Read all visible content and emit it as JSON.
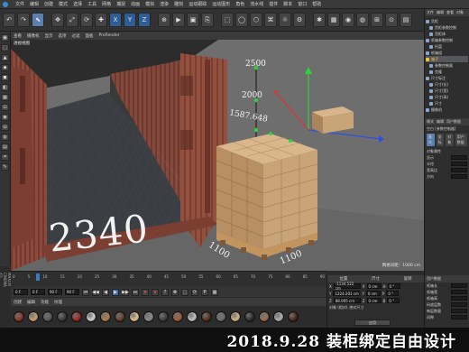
{
  "menubar": {
    "items": [
      "文件",
      "编辑",
      "创建",
      "模式",
      "选择",
      "工具",
      "网格",
      "捕捉",
      "动画",
      "模拟",
      "渲染",
      "雕刻",
      "运动跟踪",
      "运动图形",
      "角色",
      "流水线",
      "插件",
      "脚本",
      "窗口",
      "帮助"
    ]
  },
  "toolbar": {
    "buttons": [
      "↶",
      "↷",
      "⬉",
      "✥",
      "⤢",
      "⟳",
      "✚",
      "X",
      "Y",
      "Z",
      "⊕",
      "▶",
      "▣",
      "⎘",
      "⬚",
      "◯",
      "⬡",
      "⌘",
      "☼",
      "⚙",
      "✱",
      "▦",
      "◉",
      "◍",
      "⊞",
      "⊙",
      "▤"
    ]
  },
  "left_tools": {
    "buttons": [
      "▣",
      "⬚",
      "▲",
      "◆",
      "◼",
      "◧",
      "▦",
      "⊡",
      "◉",
      "⊟",
      "◍",
      "▤",
      "⌗",
      "✎"
    ],
    "vertical_label": "MAXON CINEMA 4D"
  },
  "viewport": {
    "menu": [
      "查看",
      "摄像机",
      "显示",
      "选项",
      "过滤",
      "面板",
      "ProRender"
    ],
    "title": "透视视图",
    "grid_readout": "网格间距：1000 cm",
    "dimensions": {
      "d2500": "2500",
      "d2000": "2000",
      "d1587": "1587.648",
      "d2340": "2340",
      "d1100a": "1100",
      "d1100b": "1100"
    }
  },
  "object_manager": {
    "tabs": [
      "文件",
      "编辑",
      "查看",
      "对象"
    ],
    "items": [
      {
        "label": "货柜",
        "indent": 0,
        "highlight": false
      },
      {
        "label": "货柜参数控制",
        "indent": 1,
        "highlight": false
      },
      {
        "label": "货柜体",
        "indent": 1,
        "highlight": false
      },
      {
        "label": "纸箱参数控制",
        "indent": 0,
        "highlight": false
      },
      {
        "label": "托盘",
        "indent": 1,
        "highlight": false
      },
      {
        "label": "纸箱组",
        "indent": 0,
        "highlight": false
      },
      {
        "label": "箱子",
        "indent": 0,
        "highlight": true
      },
      {
        "label": "参数控制器",
        "indent": 1,
        "highlight": false
      },
      {
        "label": "克隆",
        "indent": 1,
        "highlight": false
      },
      {
        "label": "尺寸标注",
        "indent": 0,
        "highlight": false
      },
      {
        "label": "尺寸(长)",
        "indent": 1,
        "highlight": false
      },
      {
        "label": "尺寸(宽)",
        "indent": 1,
        "highlight": false
      },
      {
        "label": "尺寸(高)",
        "indent": 1,
        "highlight": false
      },
      {
        "label": "尺寸",
        "indent": 1,
        "highlight": false
      },
      {
        "label": "摄像机",
        "indent": 0,
        "highlight": false
      }
    ]
  },
  "attributes": {
    "tabs": [
      "模式",
      "编辑",
      "用户数据"
    ],
    "object_label": "空白 [参数控制器]",
    "sub_tabs": [
      "基本",
      "坐标",
      "对象",
      "用户数据"
    ],
    "section": "对象属性",
    "rows": [
      "显示",
      "半径",
      "宽高比",
      "方向"
    ],
    "user_data_title": "用户数据",
    "user_rows": [
      "纸箱长",
      "纸箱宽",
      "纸箱高",
      "码放层数",
      "每层数量",
      "间隙",
      "托盘尺寸",
      "托盘高",
      "偏移",
      "纸箱重"
    ]
  },
  "timeline": {
    "ticks": [
      "0",
      "5",
      "10",
      "15",
      "20",
      "25",
      "30",
      "35",
      "40",
      "45",
      "50",
      "55",
      "60",
      "65",
      "70",
      "75",
      "80",
      "85",
      "90"
    ],
    "current_frame": "0 F",
    "start_field": "0 F",
    "end_field": "90 F",
    "end_field2": "90 F",
    "buttons": [
      "⏮",
      "◀◀",
      "◀",
      "▶",
      "▶▶",
      "⏭",
      "⏺",
      "⏺",
      "?",
      "✥",
      "⬚",
      "⟳",
      "P",
      "▦"
    ]
  },
  "materials": {
    "menu": [
      "创建",
      "编辑",
      "功能",
      "纹理"
    ],
    "balls": [
      "#8a3a2a",
      "#c8a070",
      "#5a5a5a",
      "#3a3a3a",
      "#9a2a20",
      "#d0d0d0",
      "#b08050",
      "#6a4030",
      "#e0c090",
      "#8a8a8a",
      "#404040",
      "#a06040",
      "#c0c0c0",
      "#5a3020",
      "#707070",
      "#d4b48a",
      "#2e2e2e",
      "#9a7050",
      "#b0b0b0",
      "#4a2a1a"
    ]
  },
  "coordinates": {
    "headers": [
      "位置",
      "尺寸",
      "旋转"
    ],
    "rows": [
      {
        "axis": "X",
        "pos": "-1134.522 cm",
        "axis2": "X",
        "size": "0 cm",
        "rot_label": "H",
        "rot": "0 °"
      },
      {
        "axis": "Y",
        "pos": "1224.201 cm",
        "axis2": "Y",
        "size": "0 cm",
        "rot_label": "P",
        "rot": "0 °"
      },
      {
        "axis": "Z",
        "pos": "88.005 cm",
        "axis2": "Z",
        "size": "0 cm",
        "rot_label": "B",
        "rot": "0 °"
      }
    ],
    "mode": "对象 (相对)",
    "size_mode": "绝对尺寸",
    "apply": "应用"
  },
  "caption": "2018.9.28 装柜绑定自由设计",
  "colors": {
    "container": "#8c4a3c",
    "container_dark": "#5a2c24",
    "floor": "#3c3f44",
    "box": "#c9a479",
    "box_dark": "#a9845c",
    "pallet": "#b78b58",
    "axis_x": "#e03030",
    "axis_y": "#30d040",
    "axis_z": "#3050e0",
    "highlight": "#f0c040"
  }
}
